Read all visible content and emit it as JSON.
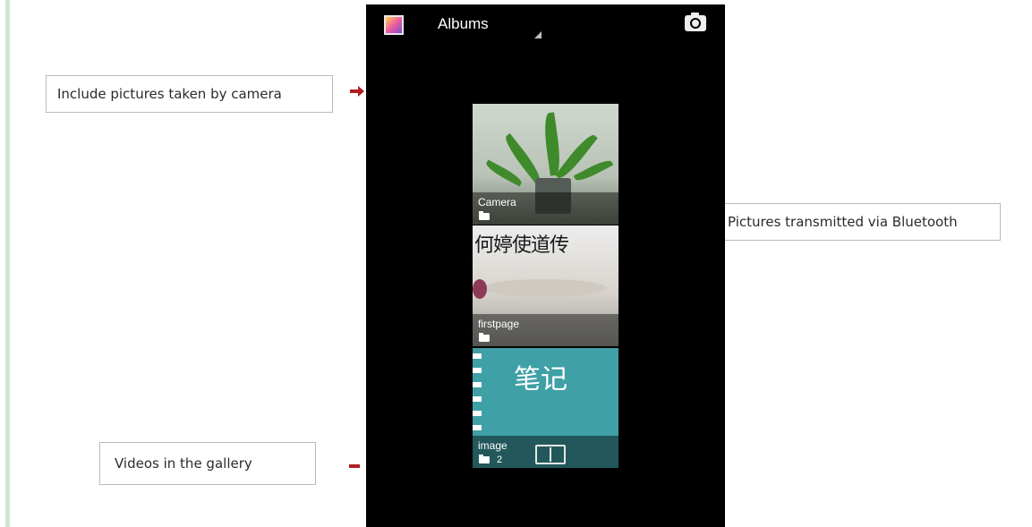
{
  "annotations": {
    "camera": "Include pictures taken by camera",
    "bluetooth": "Pictures transmitted via Bluetooth",
    "videos": "Videos in the gallery"
  },
  "header": {
    "app_icon": "gallery-icon",
    "title": "Albums",
    "camera_icon": "camera-icon"
  },
  "albums": [
    {
      "label": "Camera",
      "count": ""
    },
    {
      "label": "firstpage",
      "count": ""
    },
    {
      "label": "image",
      "count": "2",
      "thumb_text": "笔记"
    }
  ],
  "colors": {
    "arrow": "#b01f24",
    "screen_bg": "#000000",
    "image_album": "#3fa0a6"
  }
}
